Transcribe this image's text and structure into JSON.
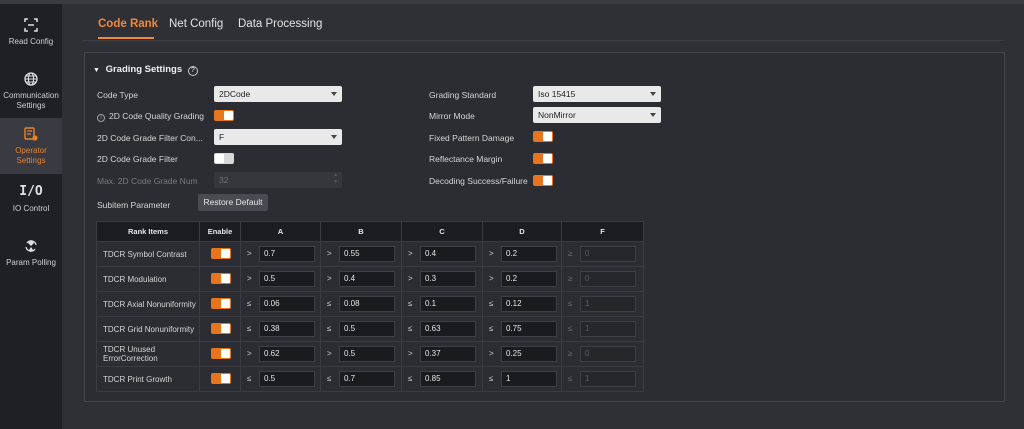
{
  "sidebar": {
    "items": [
      {
        "label": "Read Config",
        "icon": "scan-frame-icon"
      },
      {
        "label": "Communication Settings",
        "icon": "globe-icon"
      },
      {
        "label": "Operator Settings",
        "icon": "operator-icon"
      },
      {
        "label": "IO Control",
        "icon": "io-icon"
      },
      {
        "label": "Param Polling",
        "icon": "polling-icon"
      }
    ],
    "active_index": 2
  },
  "tabs": [
    "Code Rank",
    "Net Config",
    "Data Processing"
  ],
  "active_tab": "Code Rank",
  "section": {
    "title": "Grading Settings",
    "help": "?"
  },
  "left_form": {
    "code_type_label": "Code Type",
    "code_type_value": "2DCode",
    "quality_grading_label": "2D Code Quality Grading",
    "quality_grading_on": true,
    "grade_filter_condition_label": "2D Code Grade Filter Con...",
    "grade_filter_condition_value": "F",
    "grade_filter_label": "2D Code Grade Filter",
    "grade_filter_on": false,
    "max_grade_num_label": "Max. 2D Code Grade Num",
    "max_grade_num_value": "32",
    "subitem_label": "Subitem Parameter",
    "restore_label": "Restore Default"
  },
  "right_form": {
    "grading_standard_label": "Grading Standard",
    "grading_standard_value": "Iso 15415",
    "mirror_mode_label": "Mirror Mode",
    "mirror_mode_value": "NonMirror",
    "fixed_pattern_label": "Fixed Pattern Damage",
    "fixed_pattern_on": true,
    "reflectance_label": "Reflectance Margin",
    "reflectance_on": true,
    "decoding_label": "Decoding Success/Failure",
    "decoding_on": true
  },
  "table": {
    "headers": [
      "Rank Items",
      "Enable",
      "A",
      "B",
      "C",
      "D",
      "F"
    ],
    "rows": [
      {
        "name": "TDCR Symbol Contrast",
        "enabled": true,
        "op": ">",
        "op_f": "≥",
        "a": "0.7",
        "b": "0.55",
        "c": "0.4",
        "d": "0.2",
        "f": "0"
      },
      {
        "name": "TDCR Modulation",
        "enabled": true,
        "op": ">",
        "op_f": "≥",
        "a": "0.5",
        "b": "0.4",
        "c": "0.3",
        "d": "0.2",
        "f": "0"
      },
      {
        "name": "TDCR Axial Nonuniformity",
        "enabled": true,
        "op": "≤",
        "op_f": "≤",
        "a": "0.06",
        "b": "0.08",
        "c": "0.1",
        "d": "0.12",
        "f": "1"
      },
      {
        "name": "TDCR Grid Nonuniformity",
        "enabled": true,
        "op": "≤",
        "op_f": "≤",
        "a": "0.38",
        "b": "0.5",
        "c": "0.63",
        "d": "0.75",
        "f": "1"
      },
      {
        "name": "TDCR Unused ErrorCorrection",
        "enabled": true,
        "op": ">",
        "op_f": "≥",
        "a": "0.62",
        "b": "0.5",
        "c": "0.37",
        "d": "0.25",
        "f": "0"
      },
      {
        "name": "TDCR Print Growth",
        "enabled": true,
        "op": "≤",
        "op_f": "≤",
        "a": "0.5",
        "b": "0.7",
        "c": "0.85",
        "d": "1",
        "f": "1"
      }
    ]
  },
  "colors": {
    "accent": "#f0883a",
    "toggle_on": "#e8741c"
  }
}
